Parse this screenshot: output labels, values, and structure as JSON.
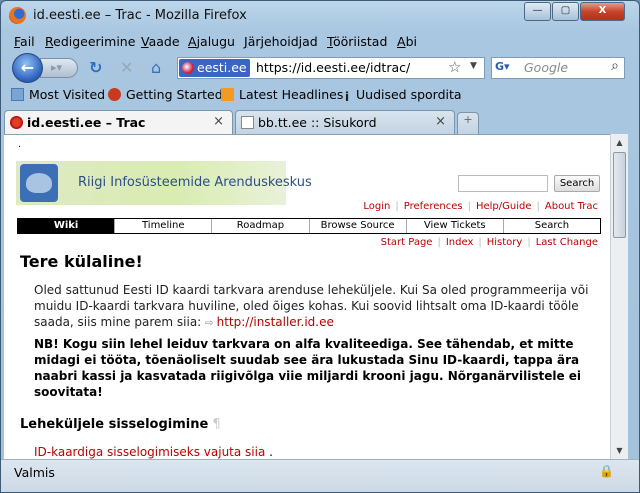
{
  "window": {
    "title": "id.eesti.ee – Trac - Mozilla Firefox",
    "controls": {
      "minimize": "—",
      "maximize": "▢",
      "close": "X"
    }
  },
  "menu": [
    {
      "label": "Fail",
      "u": "F",
      "rest": "ail"
    },
    {
      "label": "Redigeerimine",
      "u": "R",
      "rest": "edigeerimine"
    },
    {
      "label": "Vaade",
      "u": "V",
      "rest": "aade"
    },
    {
      "label": "Ajalugu",
      "u": "A",
      "rest": "jalugu"
    },
    {
      "label": "Järjehoidjad",
      "u": "J",
      "rest": "ärjehoidjad"
    },
    {
      "label": "Tööriistad",
      "u": "T",
      "rest": "ööriistad"
    },
    {
      "label": "Abi",
      "u": "A",
      "rest": "bi"
    }
  ],
  "nav": {
    "site_identity": "eesti.ee",
    "url": "https://id.eesti.ee/idtrac/",
    "search_placeholder": "Google",
    "icons": {
      "back": "back-arrow-icon",
      "forward": "forward-arrow-icon",
      "reload": "reload-icon",
      "stop": "stop-icon",
      "home": "home-icon"
    }
  },
  "bookmarks": [
    "Most Visited",
    "Getting Started",
    "Latest Headlines",
    "Uudised spordita"
  ],
  "tabs": [
    {
      "label": "id.eesti.ee – Trac",
      "active": true
    },
    {
      "label": "bb.tt.ee :: Sisukord",
      "active": false
    }
  ],
  "page": {
    "dot": ".",
    "logo_text": "Riigi Infosüsteemide Arenduskeskus",
    "search_button": "Search",
    "metanav": [
      "Login",
      "Preferences",
      "Help/Guide",
      "About Trac"
    ],
    "mainnav": [
      "Wiki",
      "Timeline",
      "Roadmap",
      "Browse Source",
      "View Tickets",
      "Search"
    ],
    "ctxtnav": [
      "Start Page",
      "Index",
      "History",
      "Last Change"
    ],
    "heading": "Tere külaline!",
    "intro": "Oled sattunud Eesti ID kaardi tarkvara arenduse leheküljele. Kui Sa oled programmeerija või muidu ID-kaardi tarkvara huviline, oled õiges kohas. Kui soovid lihtsalt oma ID-kaardi tööle saada, siis mine parem siia:",
    "installer_link": "http://installer.id.ee",
    "warning": "NB! Kogu siin lehel leiduv tarkvara on alfa kvaliteediga. See tähendab, et mitte midagi ei tööta, tõenäoliselt suudab see ära lukustada Sinu ID-kaardi, tappa ära naabri kassi ja kasvatada riigivõlga viie miljardi krooni jagu. Nõrganärvilistele ei soovitata!",
    "section_heading": "Leheküljele sisselogimine",
    "pilcrow": "¶",
    "login_link": "ID-kaardiga sisselogimiseks vajuta siia",
    "login_after": "."
  },
  "status": {
    "text": "Valmis"
  }
}
